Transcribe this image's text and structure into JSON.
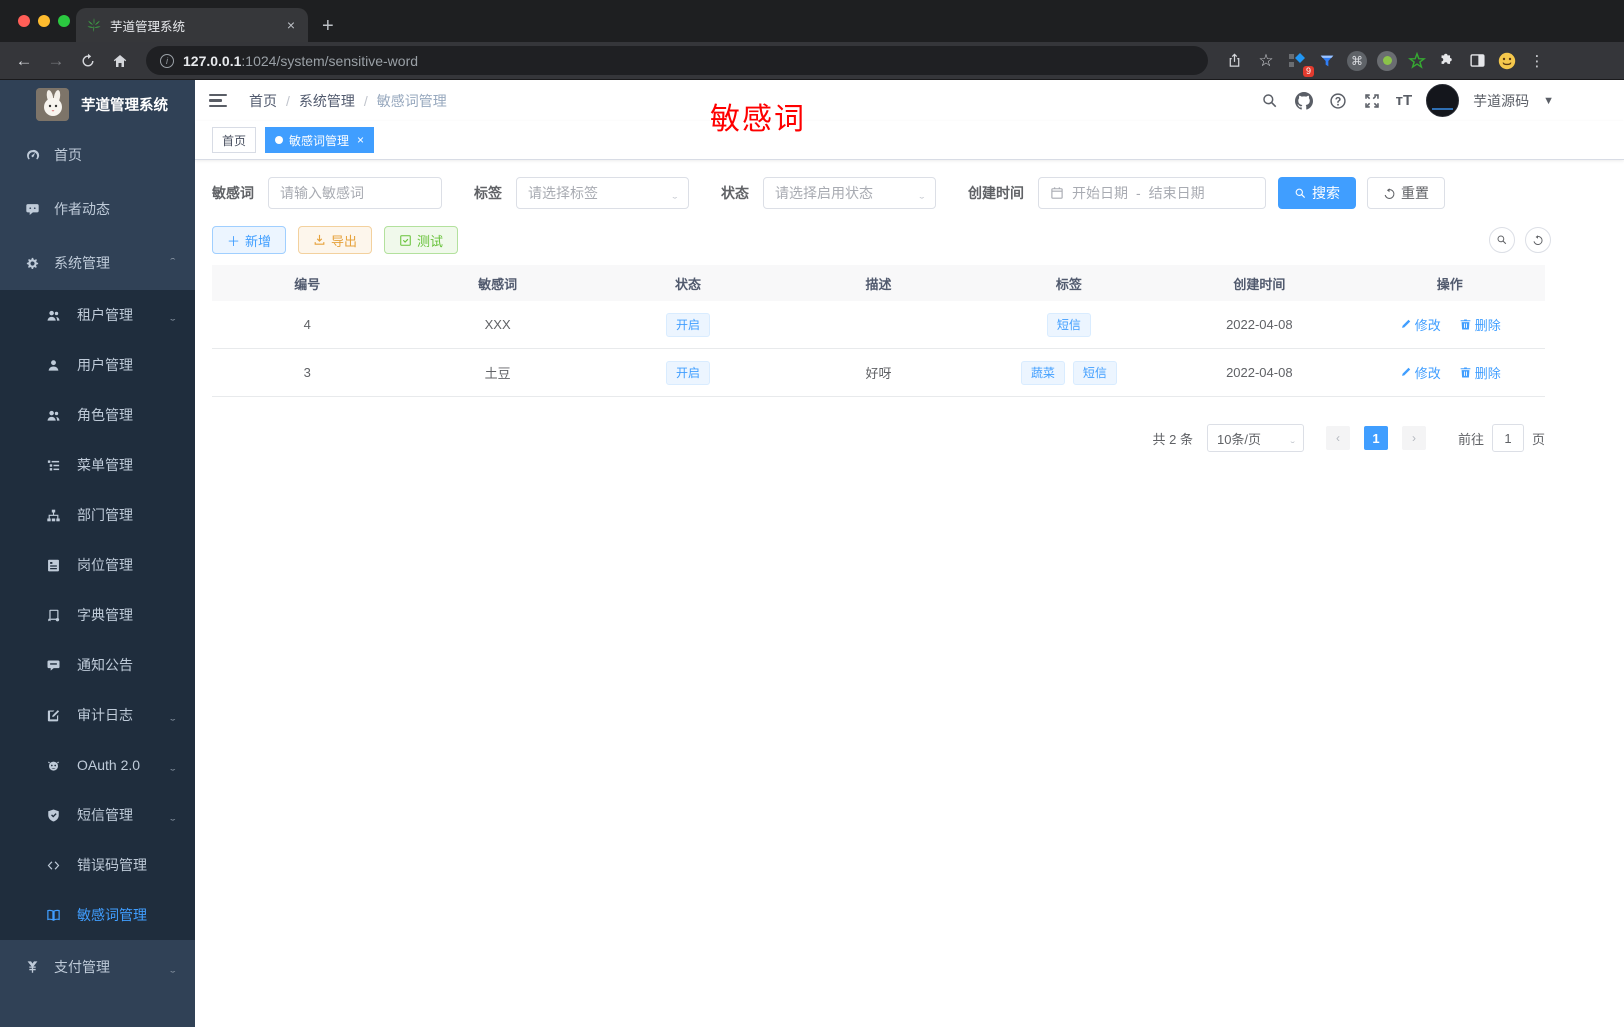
{
  "browser": {
    "tab_title": "芋道管理系统",
    "url_host": "127.0.0.1",
    "url_rest": ":1024/system/sensitive-word",
    "extension_badge": "9",
    "extensions": [
      "grid-diamond-extension",
      "filter-gem-extension",
      "command-extension",
      "record-extension",
      "green-star-extension",
      "puzzle-extension",
      "side-panel-extension",
      "emoji-extension"
    ]
  },
  "sidebar": {
    "logo_title": "芋道管理系统",
    "items": [
      {
        "label": "首页",
        "icon": "dashboard-icon",
        "level": 1
      },
      {
        "label": "作者动态",
        "icon": "chat-icon",
        "level": 1
      },
      {
        "label": "系统管理",
        "icon": "gear-icon",
        "level": 1,
        "chevron": "up"
      },
      {
        "label": "租户管理",
        "icon": "tenant-icon",
        "level": 2,
        "chevron": "down"
      },
      {
        "label": "用户管理",
        "icon": "user-icon",
        "level": 2
      },
      {
        "label": "角色管理",
        "icon": "role-icon",
        "level": 2
      },
      {
        "label": "菜单管理",
        "icon": "menu-tree-icon",
        "level": 2
      },
      {
        "label": "部门管理",
        "icon": "dept-icon",
        "level": 2
      },
      {
        "label": "岗位管理",
        "icon": "post-icon",
        "level": 2
      },
      {
        "label": "字典管理",
        "icon": "dict-icon",
        "level": 2
      },
      {
        "label": "通知公告",
        "icon": "notice-icon",
        "level": 2
      },
      {
        "label": "审计日志",
        "icon": "audit-log-icon",
        "level": 2,
        "chevron": "down"
      },
      {
        "label": "OAuth 2.0",
        "icon": "oauth-icon",
        "level": 2,
        "chevron": "down"
      },
      {
        "label": "短信管理",
        "icon": "sms-icon",
        "level": 2,
        "chevron": "down"
      },
      {
        "label": "错误码管理",
        "icon": "error-code-icon",
        "level": 2
      },
      {
        "label": "敏感词管理",
        "icon": "sensitive-word-icon",
        "level": 2,
        "active": true
      },
      {
        "label": "支付管理",
        "icon": "pay-icon",
        "level": 1,
        "chevron": "down"
      }
    ]
  },
  "header": {
    "breadcrumb": [
      "首页",
      "系统管理",
      "敏感词管理"
    ],
    "annotation": "敏感词",
    "username": "芋道源码"
  },
  "tags": [
    {
      "label": "首页",
      "active": false
    },
    {
      "label": "敏感词管理",
      "active": true,
      "closable": true
    }
  ],
  "filters": {
    "keyword_label": "敏感词",
    "keyword_placeholder": "请输入敏感词",
    "tag_label": "标签",
    "tag_placeholder": "请选择标签",
    "status_label": "状态",
    "status_placeholder": "请选择启用状态",
    "date_label": "创建时间",
    "date_start_placeholder": "开始日期",
    "date_separator": "-",
    "date_end_placeholder": "结束日期",
    "search_label": "搜索",
    "reset_label": "重置"
  },
  "toolbar": {
    "add_label": "新增",
    "export_label": "导出",
    "test_label": "测试"
  },
  "table": {
    "columns": [
      "编号",
      "敏感词",
      "状态",
      "描述",
      "标签",
      "创建时间",
      "操作"
    ],
    "rows": [
      {
        "id": "4",
        "word": "XXX",
        "status": "开启",
        "desc": "",
        "tags": [
          "短信"
        ],
        "created": "2022-04-08"
      },
      {
        "id": "3",
        "word": "土豆",
        "status": "开启",
        "desc": "好呀",
        "tags": [
          "蔬菜",
          "短信"
        ],
        "created": "2022-04-08"
      }
    ],
    "edit_label": "修改",
    "delete_label": "删除"
  },
  "pagination": {
    "total": "共 2 条",
    "page_size": "10条/页",
    "current_page": "1",
    "goto_label": "前往",
    "goto_value": "1",
    "page_suffix": "页"
  },
  "colors": {
    "accent": "#409eff",
    "warning": "#e6a23c",
    "success": "#67c23a",
    "annotation_red": "#fe0000",
    "sidebar_bg": "#304156",
    "submenu_bg": "#1f2d3d",
    "sidebar_text": "#bfcbd9"
  }
}
